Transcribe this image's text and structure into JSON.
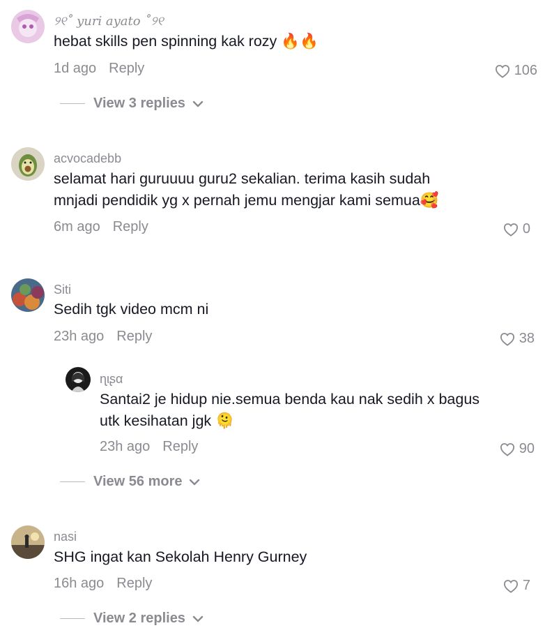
{
  "comments": [
    {
      "username": "୨୧˚ 𝑦𝑢𝑟𝑖 𝑎𝑦𝑎𝑡𝑜 ˚୨୧",
      "text": "hebat skills pen spinning kak rozy 🔥🔥",
      "time": "1d ago",
      "reply_label": "Reply",
      "likes": "106",
      "view_more": "View 3 replies"
    },
    {
      "username": "acvocadebb",
      "text": "selamat hari guruuuu guru2 sekalian. terima kasih sudah mnjadi pendidik yg x pernah jemu mengjar kami semua🥰",
      "time": "6m ago",
      "reply_label": "Reply",
      "likes": "0"
    },
    {
      "username": "Siti",
      "text": "Sedih tgk video mcm ni",
      "time": "23h ago",
      "reply_label": "Reply",
      "likes": "38",
      "view_more": "View 56 more",
      "replies": [
        {
          "username": "ɳιʂα",
          "text": "Santai2 je hidup nie.semua benda kau nak sedih x bagus utk kesihatan jgk 🫠",
          "time": "23h ago",
          "reply_label": "Reply",
          "likes": "90"
        }
      ]
    },
    {
      "username": "nasi",
      "text": "SHG ingat kan Sekolah Henry Gurney",
      "time": "16h ago",
      "reply_label": "Reply",
      "likes": "7",
      "view_more": "View 2 replies"
    }
  ],
  "colors": {
    "text_primary": "#161823",
    "text_secondary": "#8a8b91"
  },
  "icons": {
    "like": "heart-outline-icon",
    "expand": "chevron-down-icon"
  }
}
